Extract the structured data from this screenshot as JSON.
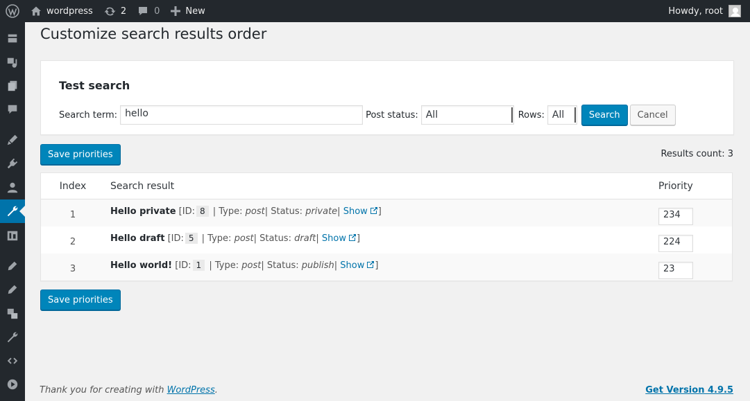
{
  "admin_bar": {
    "site_name": "wordpress",
    "updates_count": "2",
    "comments_count": "0",
    "new_label": "New",
    "greeting": "Howdy, root"
  },
  "sidebar": {
    "items": [
      {
        "icon": "dashboard-icon"
      },
      {
        "icon": "media-icon"
      },
      {
        "icon": "pages-icon"
      },
      {
        "icon": "comments-icon"
      },
      {
        "icon": "appearance-icon"
      },
      {
        "icon": "plugins-icon"
      },
      {
        "icon": "users-icon"
      },
      {
        "icon": "tools-icon",
        "current": true
      },
      {
        "icon": "settings-icon"
      },
      {
        "icon": "edit-icon"
      },
      {
        "icon": "edit-icon"
      },
      {
        "icon": "translate-icon"
      },
      {
        "icon": "wrench-icon"
      },
      {
        "icon": "code-icon"
      },
      {
        "icon": "play-icon"
      }
    ]
  },
  "page": {
    "title": "Customize search results order"
  },
  "test_search": {
    "heading": "Test search",
    "search_term_label": "Search term:",
    "search_term_value": "hello",
    "post_status_label": "Post status:",
    "post_status_value": "All",
    "rows_label": "Rows:",
    "rows_value": "All",
    "search_button": "Search",
    "cancel_button": "Cancel"
  },
  "actions": {
    "save_priorities": "Save priorities",
    "results_count": "Results count: 3"
  },
  "table": {
    "headers": {
      "index": "Index",
      "result": "Search result",
      "priority": "Priority"
    },
    "rows": [
      {
        "index": "1",
        "title": "Hello private",
        "id_prefix": "[ID:",
        "id": "8",
        "type_prefix": "| Type:",
        "type": "post",
        "status_prefix": "| Status:",
        "status": "private",
        "show_prefix": "|",
        "show": "Show",
        "suffix": "]",
        "priority": "234"
      },
      {
        "index": "2",
        "title": "Hello draft",
        "id_prefix": "[ID:",
        "id": "5",
        "type_prefix": "| Type:",
        "type": "post",
        "status_prefix": "| Status:",
        "status": "draft",
        "show_prefix": "|",
        "show": "Show",
        "suffix": "]",
        "priority": "224"
      },
      {
        "index": "3",
        "title": "Hello world!",
        "id_prefix": "[ID:",
        "id": "1",
        "type_prefix": "| Type:",
        "type": "post",
        "status_prefix": "| Status:",
        "status": "publish",
        "show_prefix": "|",
        "show": "Show",
        "suffix": "]",
        "priority": "23"
      }
    ]
  },
  "footer": {
    "thanks_prefix": "Thank you for creating with ",
    "thanks_link": "WordPress",
    "thanks_suffix": ".",
    "version_link": "Get Version 4.9.5"
  },
  "colors": {
    "primary": "#0085ba",
    "admin_bar": "#23282d",
    "link": "#0073aa"
  }
}
